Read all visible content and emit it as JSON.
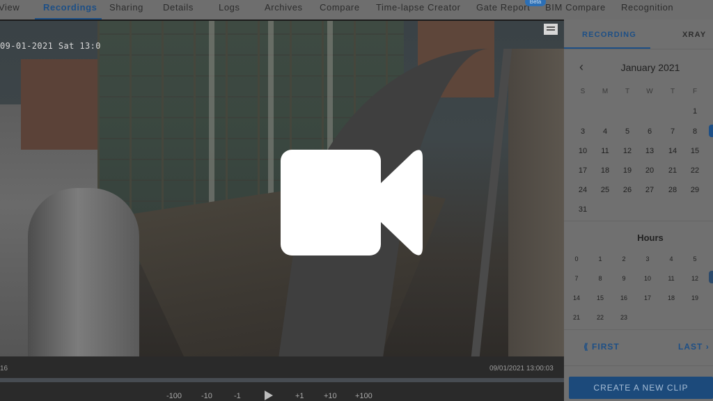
{
  "nav": {
    "tabs": [
      {
        "label": "View",
        "active": false
      },
      {
        "label": "Recordings",
        "active": true
      },
      {
        "label": "Sharing",
        "active": false
      },
      {
        "label": "Details",
        "active": false
      },
      {
        "label": "Logs",
        "active": false
      },
      {
        "label": "Archives",
        "active": false
      },
      {
        "label": "Compare",
        "active": false
      },
      {
        "label": "Time-lapse Creator",
        "active": false
      },
      {
        "label": "Gate Report",
        "active": false
      },
      {
        "label": "BIM Compare",
        "active": false
      },
      {
        "label": "Recognition",
        "active": false
      }
    ],
    "beta_badge": "Beta",
    "accent_color": "#1d4f86"
  },
  "video": {
    "overlay_timestamp": "09-01-2021 Sat 13:0",
    "center_icon": "video-camera-icon",
    "corner_icon": "archive-icon"
  },
  "player": {
    "time_left": "16",
    "time_right": "09/01/2021 13:00:03",
    "controls": {
      "minus100": "-100",
      "minus10": "-10",
      "minus1": "-1",
      "play_icon": "play-icon",
      "plus1": "+1",
      "plus10": "+10",
      "plus100": "+100"
    }
  },
  "panel": {
    "tabs": {
      "recording": "RECORDING",
      "xray": "XRAY"
    },
    "calendar": {
      "month": "January 2021",
      "weekday_headers": [
        "S",
        "M",
        "T",
        "W",
        "T",
        "F"
      ],
      "days": [
        "1",
        "3",
        "4",
        "5",
        "6",
        "7",
        "8",
        "10",
        "11",
        "12",
        "13",
        "14",
        "15",
        "17",
        "18",
        "19",
        "20",
        "21",
        "22",
        "24",
        "25",
        "26",
        "27",
        "28",
        "29",
        "31"
      ]
    },
    "hours": {
      "title": "Hours",
      "values": [
        "0",
        "1",
        "2",
        "3",
        "4",
        "5",
        "7",
        "8",
        "9",
        "10",
        "11",
        "12",
        "14",
        "15",
        "16",
        "17",
        "18",
        "19",
        "21",
        "22",
        "23"
      ]
    },
    "first_label": "FIRST",
    "last_label": "LAST",
    "create_clip_label": "CREATE A NEW CLIP"
  }
}
